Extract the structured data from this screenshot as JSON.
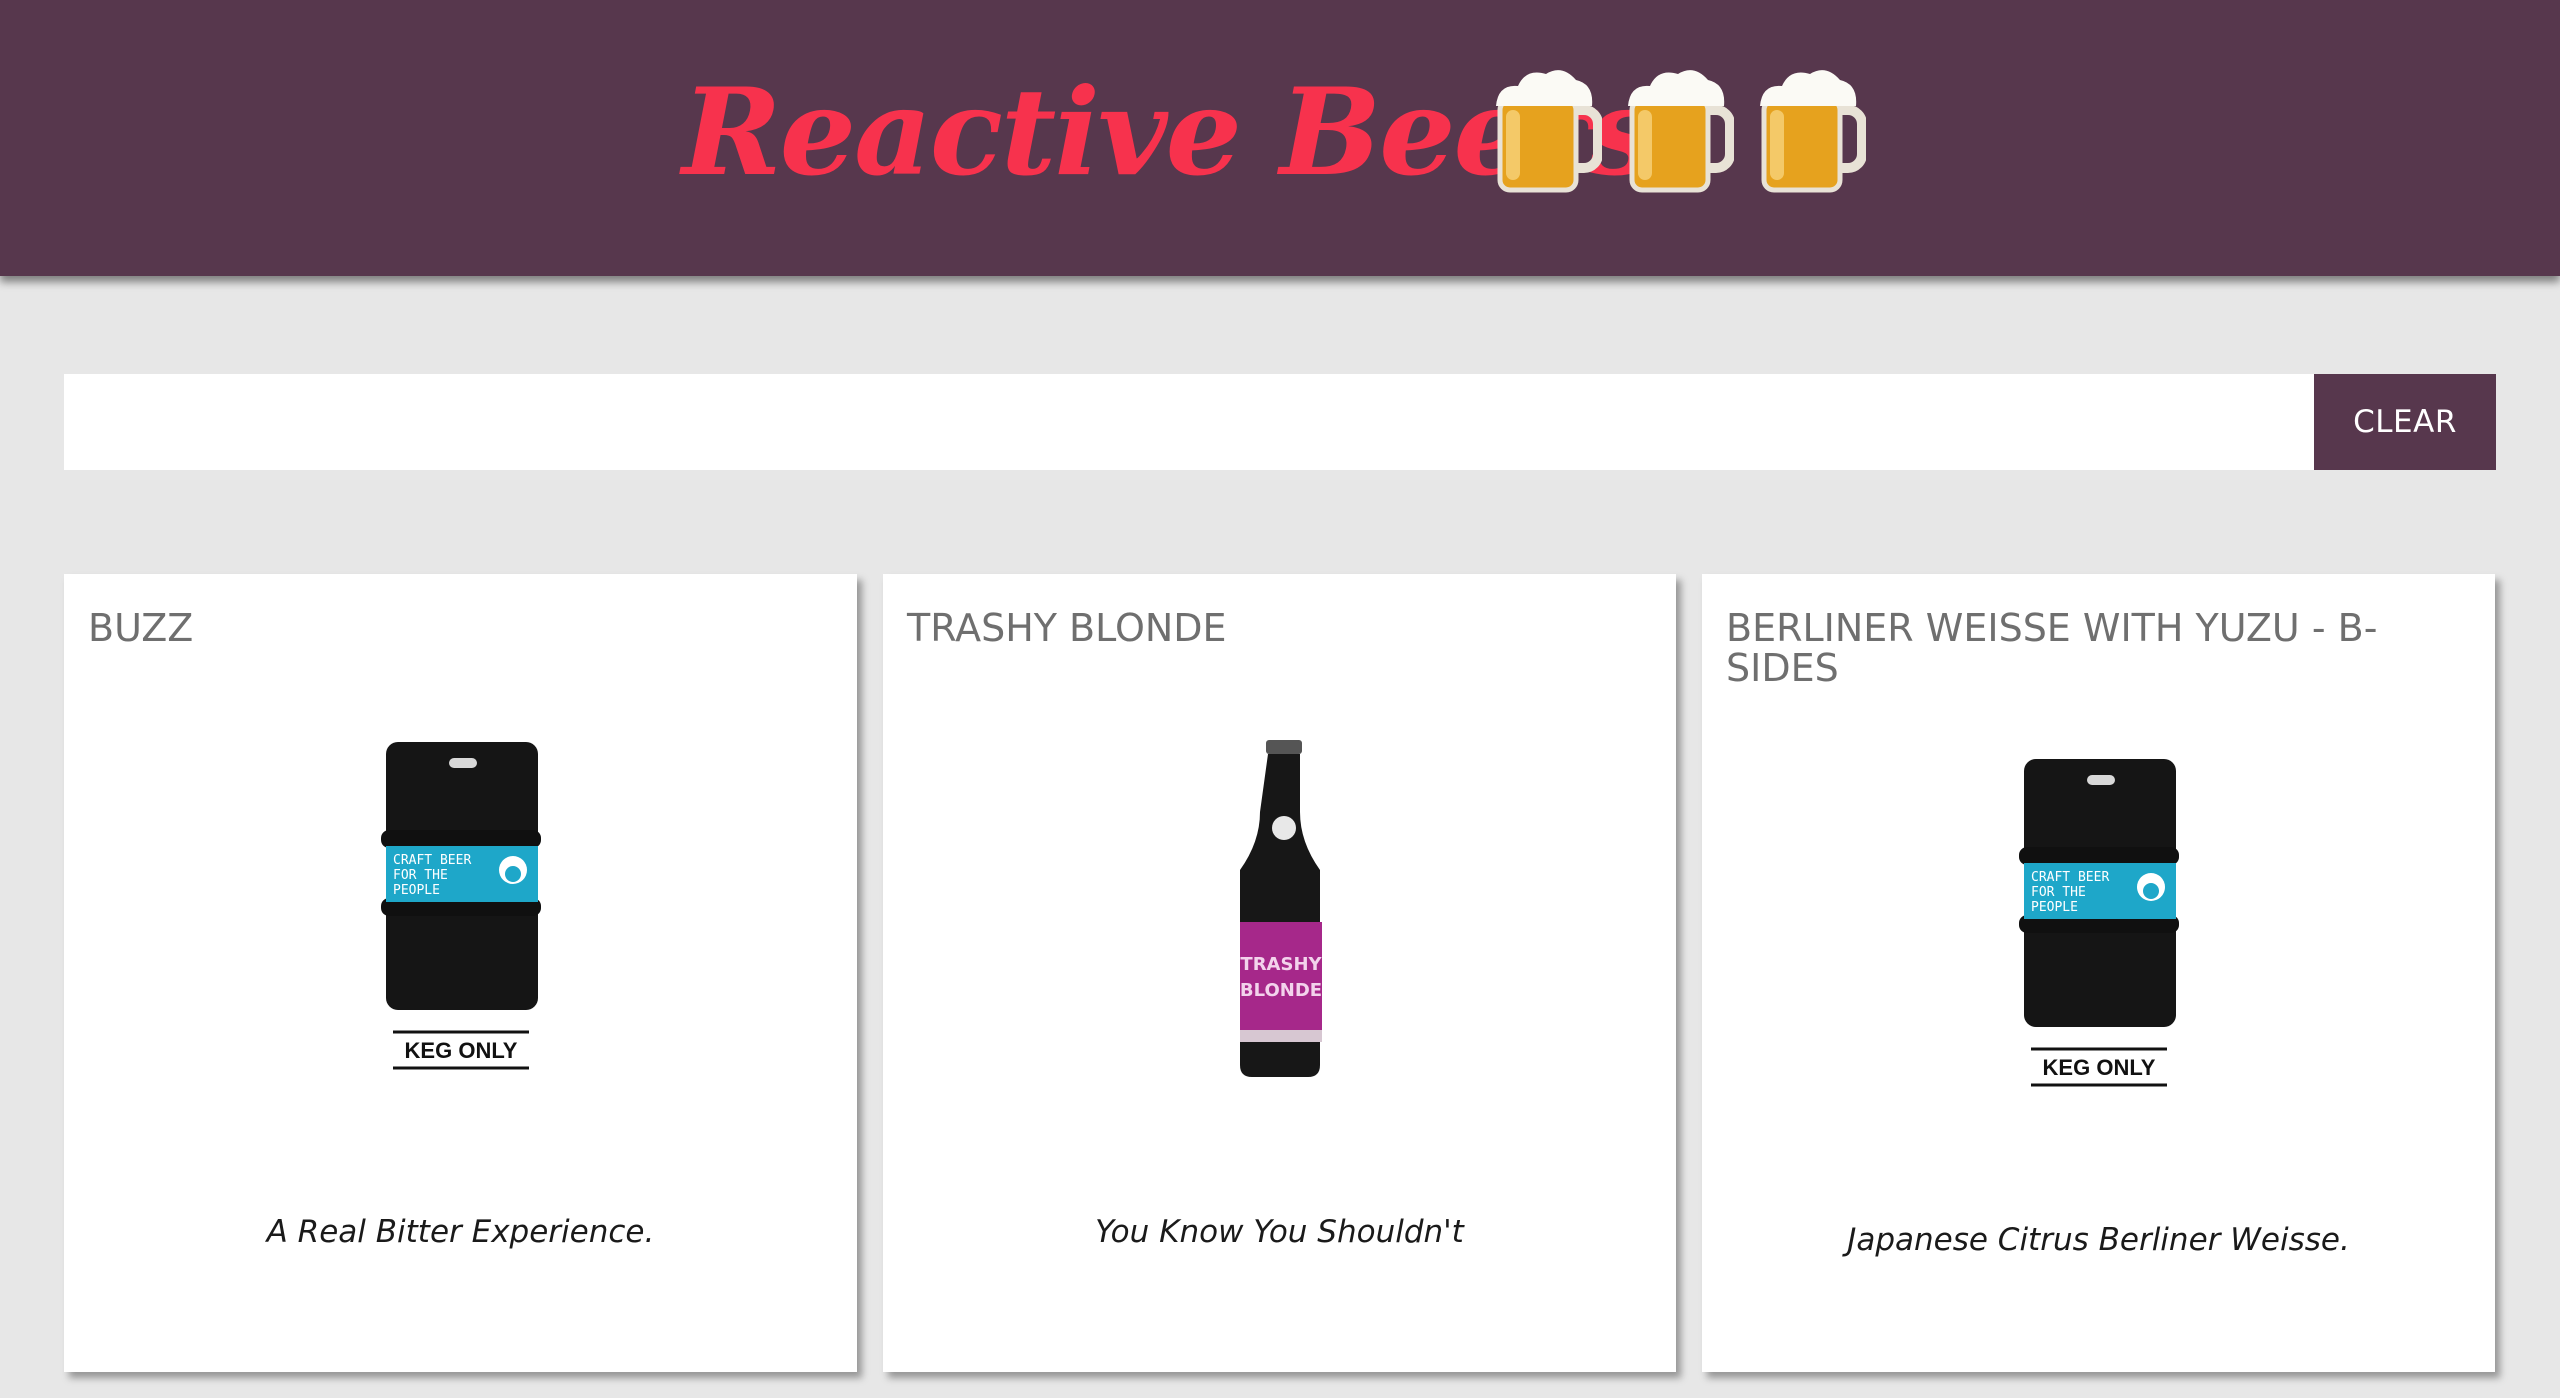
{
  "header": {
    "title": "Reactive Beers",
    "icons": [
      "beer-mug-icon",
      "beer-mug-icon",
      "beer-mug-icon"
    ]
  },
  "search": {
    "value": "",
    "placeholder": "",
    "clear_label": "CLEAR"
  },
  "colors": {
    "header_bg": "#57374d",
    "title": "#f7324d",
    "page_bg": "#e7e7e7",
    "keg_label": "#1ea7c9",
    "bottle_label": "#a6288a"
  },
  "beers": [
    {
      "name": "BUZZ",
      "image": "keg-image",
      "image_text": [
        "CRAFT BEER",
        "FOR THE",
        "PEOPLE",
        "KEG ONLY"
      ],
      "tagline": "A Real Bitter Experience."
    },
    {
      "name": "TRASHY BLONDE",
      "image": "bottle-image",
      "image_text": [
        "TRASHY",
        "BLONDE"
      ],
      "tagline": "You Know You Shouldn't"
    },
    {
      "name": "BERLINER WEISSE WITH YUZU - B-SIDES",
      "image": "keg-image",
      "image_text": [
        "CRAFT BEER",
        "FOR THE",
        "PEOPLE",
        "KEG ONLY"
      ],
      "tagline": "Japanese Citrus Berliner Weisse."
    }
  ]
}
